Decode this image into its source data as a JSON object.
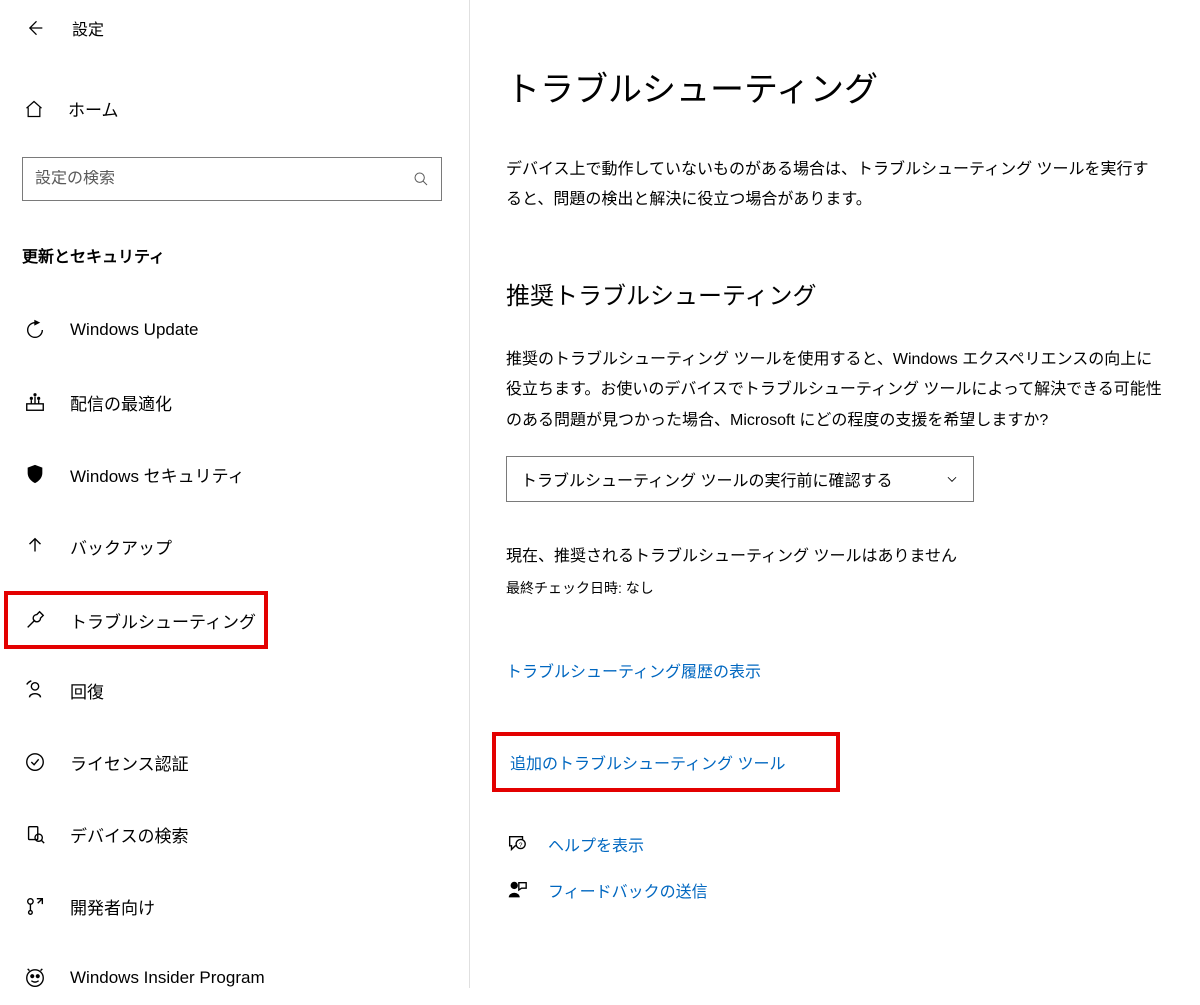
{
  "header": {
    "title": "設定"
  },
  "home": {
    "label": "ホーム"
  },
  "search": {
    "placeholder": "設定の検索"
  },
  "section_label": "更新とセキュリティ",
  "nav": [
    {
      "id": "windows-update",
      "label": "Windows Update"
    },
    {
      "id": "delivery-optimization",
      "label": "配信の最適化"
    },
    {
      "id": "windows-security",
      "label": "Windows セキュリティ"
    },
    {
      "id": "backup",
      "label": "バックアップ"
    },
    {
      "id": "troubleshoot",
      "label": "トラブルシューティング"
    },
    {
      "id": "recovery",
      "label": "回復"
    },
    {
      "id": "activation",
      "label": "ライセンス認証"
    },
    {
      "id": "find-my-device",
      "label": "デバイスの検索"
    },
    {
      "id": "for-developers",
      "label": "開発者向け"
    },
    {
      "id": "windows-insider",
      "label": "Windows Insider Program"
    }
  ],
  "main": {
    "page_title": "トラブルシューティング",
    "lead": "デバイス上で動作していないものがある場合は、トラブルシューティング ツールを実行すると、問題の検出と解決に役立つ場合があります。",
    "recommended_h": "推奨トラブルシューティング",
    "recommended_p": "推奨のトラブルシューティング ツールを使用すると、Windows エクスペリエンスの向上に役立ちます。お使いのデバイスでトラブルシューティング ツールによって解決できる可能性のある問題が見つかった場合、Microsoft にどの程度の支援を希望しますか?",
    "dropdown_selected": "トラブルシューティング ツールの実行前に確認する",
    "status": "現在、推奨されるトラブルシューティング ツールはありません",
    "lastcheck": "最終チェック日時: なし",
    "link_history": "トラブルシューティング履歴の表示",
    "link_additional": "追加のトラブルシューティング ツール",
    "help_link": "ヘルプを表示",
    "feedback_link": "フィードバックの送信"
  },
  "colors": {
    "link": "#0067c0",
    "highlight_border": "#e30000"
  }
}
